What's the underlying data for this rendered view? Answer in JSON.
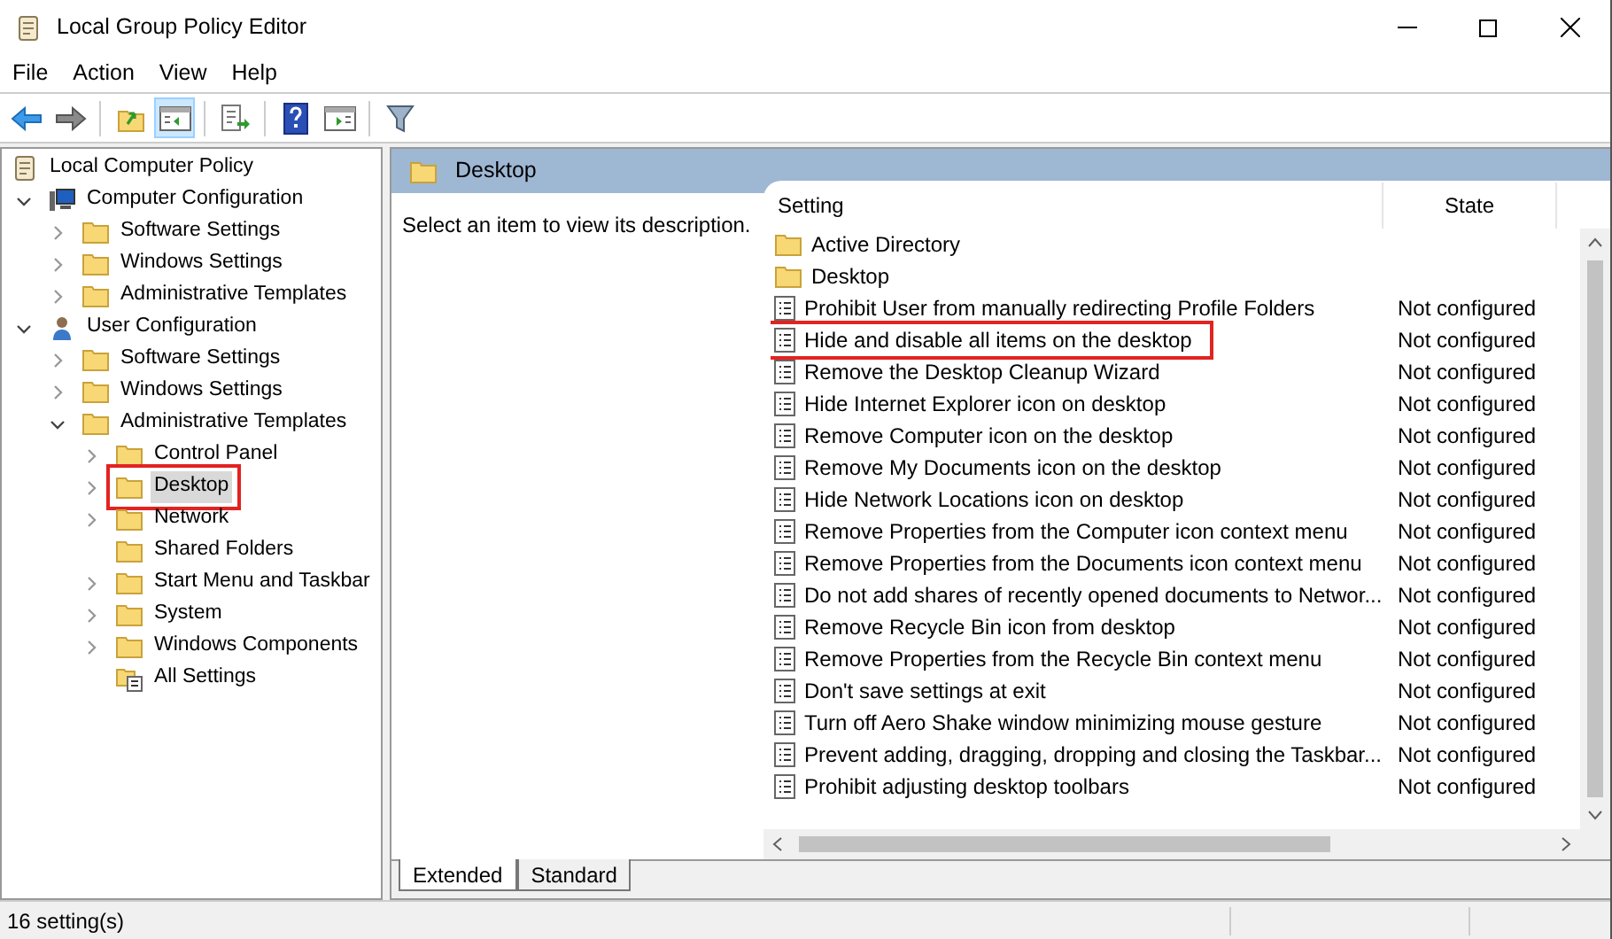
{
  "window": {
    "title": "Local Group Policy Editor"
  },
  "menu": [
    "File",
    "Action",
    "View",
    "Help"
  ],
  "toolbar": [
    {
      "kind": "back",
      "pressed": false
    },
    {
      "kind": "forward",
      "pressed": false
    },
    {
      "kind": "sep"
    },
    {
      "kind": "up",
      "pressed": false
    },
    {
      "kind": "tree",
      "pressed": true
    },
    {
      "kind": "sep"
    },
    {
      "kind": "export",
      "pressed": false
    },
    {
      "kind": "sep"
    },
    {
      "kind": "help",
      "pressed": false
    },
    {
      "kind": "pane",
      "pressed": false
    },
    {
      "kind": "sep"
    },
    {
      "kind": "filter",
      "pressed": false
    }
  ],
  "tree": [
    {
      "label": "Local Computer Policy",
      "kind": "policy",
      "selected": false,
      "highlighted": false,
      "children": [
        {
          "label": "Computer Configuration",
          "kind": "computer",
          "expanded": true,
          "selected": false,
          "highlighted": false,
          "children": [
            {
              "label": "Software Settings",
              "kind": "folder",
              "expanded": false,
              "selected": false,
              "highlighted": false
            },
            {
              "label": "Windows Settings",
              "kind": "folder",
              "expanded": false,
              "selected": false,
              "highlighted": false
            },
            {
              "label": "Administrative Templates",
              "kind": "folder",
              "expanded": false,
              "selected": false,
              "highlighted": false
            }
          ]
        },
        {
          "label": "User Configuration",
          "kind": "user",
          "expanded": true,
          "selected": false,
          "highlighted": false,
          "children": [
            {
              "label": "Software Settings",
              "kind": "folder",
              "expanded": false,
              "selected": false,
              "highlighted": false
            },
            {
              "label": "Windows Settings",
              "kind": "folder",
              "expanded": false,
              "selected": false,
              "highlighted": false
            },
            {
              "label": "Administrative Templates",
              "kind": "folder",
              "expanded": true,
              "selected": false,
              "highlighted": false,
              "children": [
                {
                  "label": "Control Panel",
                  "kind": "folder",
                  "expanded": false,
                  "selected": false,
                  "highlighted": false
                },
                {
                  "label": "Desktop",
                  "kind": "folder",
                  "expanded": false,
                  "selected": true,
                  "highlighted": true
                },
                {
                  "label": "Network",
                  "kind": "folder",
                  "expanded": false,
                  "selected": false,
                  "highlighted": false
                },
                {
                  "label": "Shared Folders",
                  "kind": "folder",
                  "selected": false,
                  "highlighted": false
                },
                {
                  "label": "Start Menu and Taskbar",
                  "kind": "folder",
                  "expanded": false,
                  "selected": false,
                  "highlighted": false
                },
                {
                  "label": "System",
                  "kind": "folder",
                  "expanded": false,
                  "selected": false,
                  "highlighted": false
                },
                {
                  "label": "Windows Components",
                  "kind": "folder",
                  "expanded": false,
                  "selected": false,
                  "highlighted": false
                },
                {
                  "label": "All Settings",
                  "kind": "all",
                  "selected": false,
                  "highlighted": false
                }
              ]
            }
          ]
        }
      ]
    }
  ],
  "pane": {
    "title": "Desktop",
    "description": "Select an item to view its description.",
    "columns": [
      "Setting",
      "State"
    ],
    "rows": [
      {
        "kind": "folder",
        "setting": "Active Directory",
        "highlighted": false
      },
      {
        "kind": "folder",
        "setting": "Desktop",
        "highlighted": false
      },
      {
        "kind": "policy",
        "setting": "Prohibit User from manually redirecting Profile Folders",
        "state": "Not configured",
        "highlighted": false
      },
      {
        "kind": "policy",
        "setting": "Hide and disable all items on the desktop",
        "state": "Not configured",
        "highlighted": true
      },
      {
        "kind": "policy",
        "setting": "Remove the Desktop Cleanup Wizard",
        "state": "Not configured",
        "highlighted": false
      },
      {
        "kind": "policy",
        "setting": "Hide Internet Explorer icon on desktop",
        "state": "Not configured",
        "highlighted": false
      },
      {
        "kind": "policy",
        "setting": "Remove Computer icon on the desktop",
        "state": "Not configured",
        "highlighted": false
      },
      {
        "kind": "policy",
        "setting": "Remove My Documents icon on the desktop",
        "state": "Not configured",
        "highlighted": false
      },
      {
        "kind": "policy",
        "setting": "Hide Network Locations icon on desktop",
        "state": "Not configured",
        "highlighted": false
      },
      {
        "kind": "policy",
        "setting": "Remove Properties from the Computer icon context menu",
        "state": "Not configured",
        "highlighted": false
      },
      {
        "kind": "policy",
        "setting": "Remove Properties from the Documents icon context menu",
        "state": "Not configured",
        "highlighted": false
      },
      {
        "kind": "policy",
        "setting": "Do not add shares of recently opened documents to Networ...",
        "state": "Not configured",
        "highlighted": false
      },
      {
        "kind": "policy",
        "setting": "Remove Recycle Bin icon from desktop",
        "state": "Not configured",
        "highlighted": false
      },
      {
        "kind": "policy",
        "setting": "Remove Properties from the Recycle Bin context menu",
        "state": "Not configured",
        "highlighted": false
      },
      {
        "kind": "policy",
        "setting": "Don't save settings at exit",
        "state": "Not configured",
        "highlighted": false
      },
      {
        "kind": "policy",
        "setting": "Turn off Aero Shake window minimizing mouse gesture",
        "state": "Not configured",
        "highlighted": false
      },
      {
        "kind": "policy",
        "setting": "Prevent adding, dragging, dropping and closing the Taskbar...",
        "state": "Not configured",
        "highlighted": false
      },
      {
        "kind": "policy",
        "setting": "Prohibit adjusting desktop toolbars",
        "state": "Not configured",
        "highlighted": false
      }
    ],
    "tabs": [
      {
        "label": "Extended",
        "selected": true
      },
      {
        "label": "Standard",
        "selected": false
      }
    ]
  },
  "status_bar": "16 setting(s)"
}
